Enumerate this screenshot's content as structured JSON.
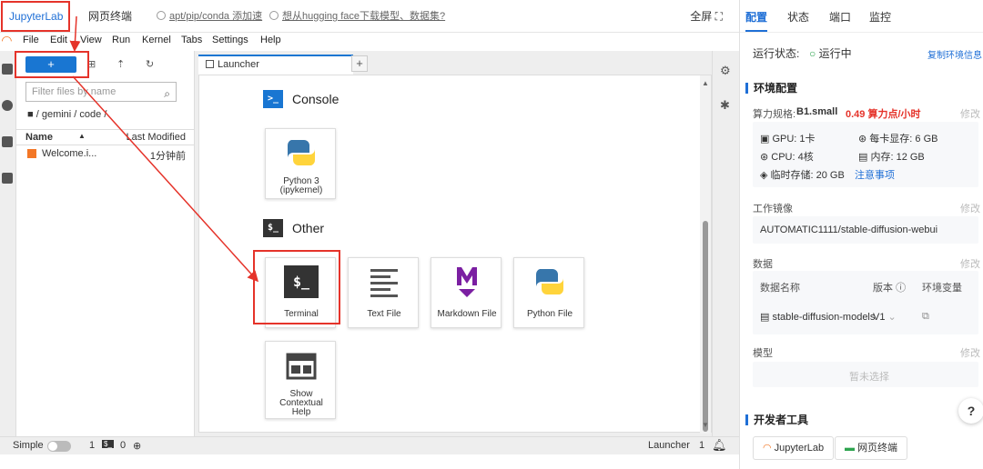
{
  "topbar": {
    "tab_jupyter": "JupyterLab",
    "tab_terminal": "网页终端",
    "link1": "apt/pip/conda 添加速",
    "link2": "想从hugging face下载模型、数据集?",
    "fullscreen": "全屏"
  },
  "menu": [
    "File",
    "Edit",
    "View",
    "Run",
    "Kernel",
    "Tabs",
    "Settings",
    "Help"
  ],
  "filebrowser": {
    "new_label": "+",
    "filter_placeholder": "Filter files by name",
    "breadcrumb": "/ gemini / code /",
    "col_name": "Name",
    "col_modified": "Last Modified",
    "files": [
      {
        "name": "Welcome.i...",
        "modified": "1分钟前"
      }
    ]
  },
  "launcher": {
    "tab_label": "Launcher",
    "add_tab": "+",
    "console_title": "Console",
    "console_icon": ">_",
    "python_card": [
      "Python 3",
      "(ipykernel)"
    ],
    "other_title": "Other",
    "other_icon": "$_",
    "terminal_icon": "$_",
    "cards": [
      "Terminal",
      "Text File",
      "Markdown File",
      "Python File"
    ],
    "help_card": [
      "Show",
      "Contextual",
      "Help"
    ]
  },
  "statusbar": {
    "simple": "Simple",
    "count1": "1",
    "count2": "0",
    "mode": "Launcher",
    "count3": "1"
  },
  "right": {
    "tabs": [
      "配置",
      "状态",
      "端口",
      "监控"
    ],
    "run_status_label": "运行状态:",
    "run_status_value": "运行中",
    "copy_env": "复制环境信息",
    "env_config": "环境配置",
    "spec_label": "算力规格:",
    "spec_value": "B1.small",
    "spec_price": "0.49 算力点/小时",
    "edit": "修改",
    "gpu": "GPU: 1卡",
    "vram": "每卡显存: 6 GB",
    "cpu": "CPU: 4核",
    "mem": "内存: 12 GB",
    "storage": "临时存储: 20 GB",
    "notice": "注意事项",
    "image_label": "工作镜像",
    "image_value": "AUTOMATIC1111/stable-diffusion-webui",
    "data_label": "数据",
    "data_col_name": "数据名称",
    "data_col_version": "版本",
    "data_col_env": "环境变量",
    "data_item": "stable-diffusion-models",
    "data_version": "V1",
    "model_label": "模型",
    "model_empty": "暂未选择",
    "dev_tools": "开发者工具",
    "dev_jupyter": "JupyterLab",
    "dev_terminal": "网页终端",
    "help": "?"
  },
  "colors": {
    "accent": "#1f6fd6",
    "orange": "#f37726",
    "annotation": "#e5332a",
    "price": "#e5332a"
  }
}
